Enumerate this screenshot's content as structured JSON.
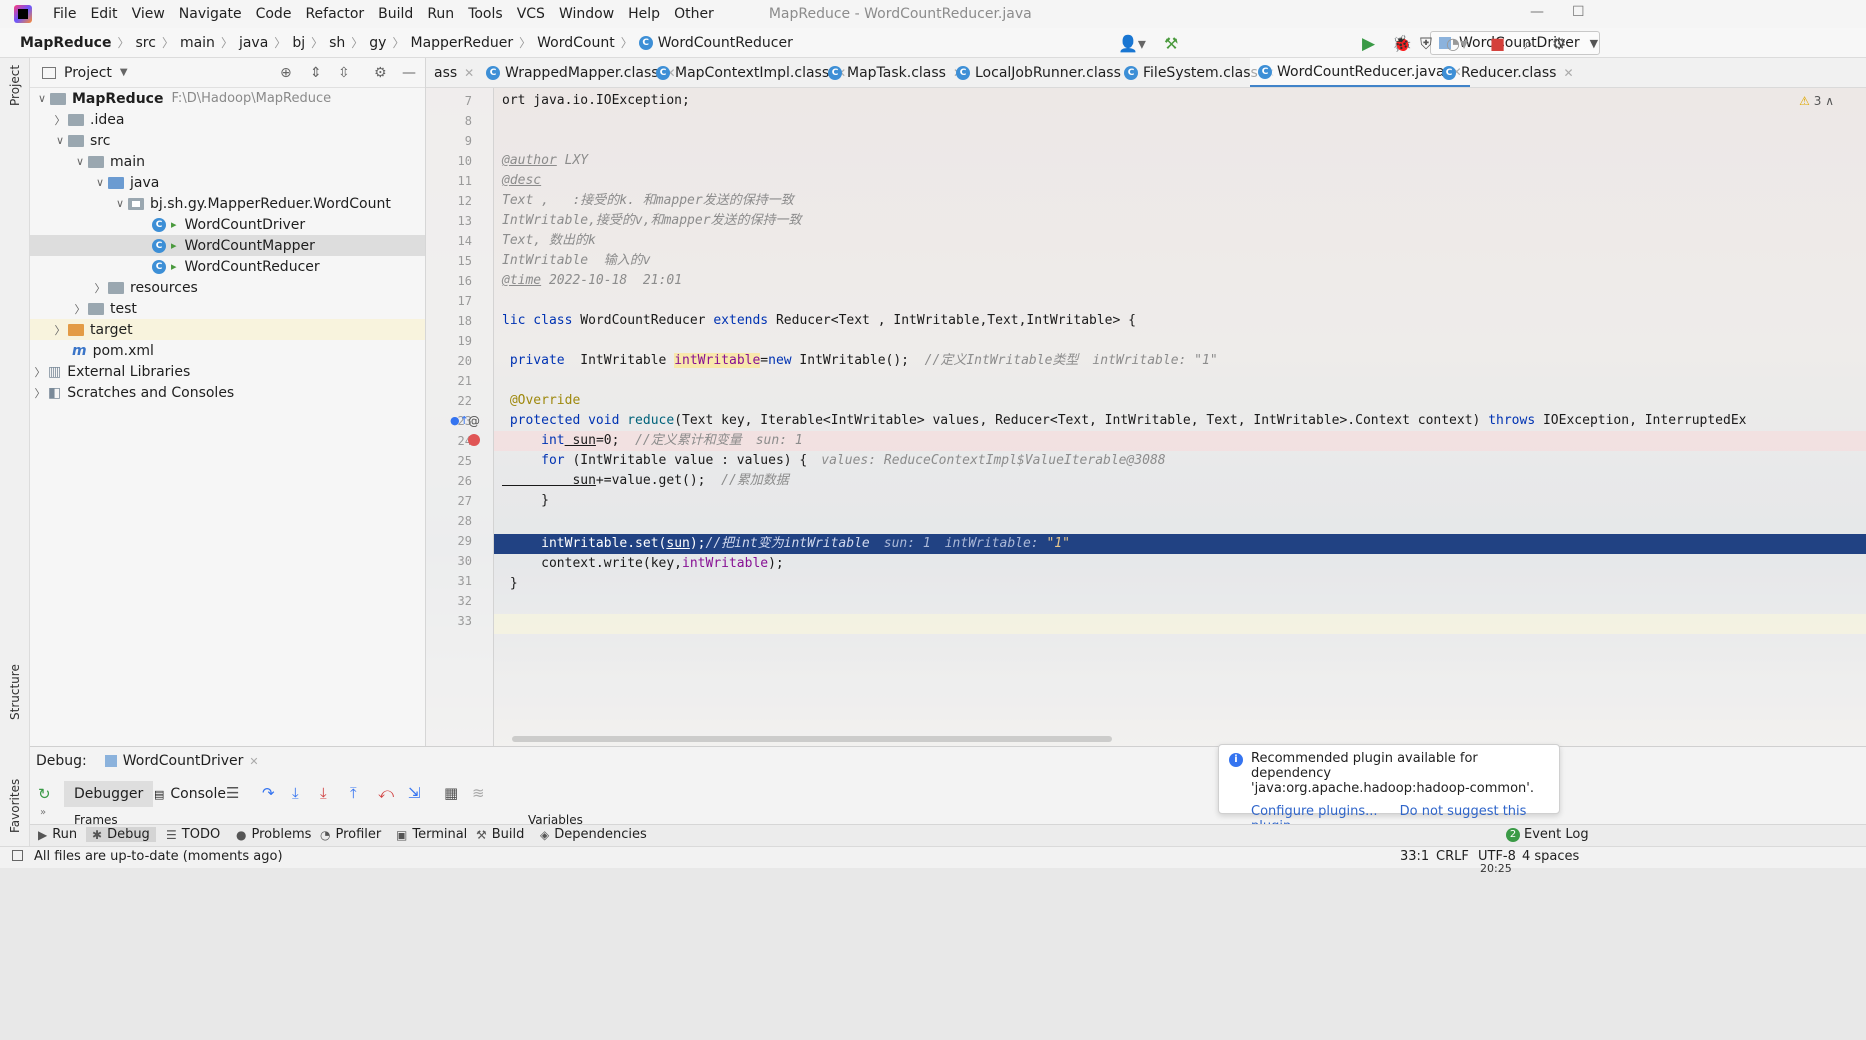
{
  "title_bar": {
    "menus": [
      "File",
      "Edit",
      "View",
      "Navigate",
      "Code",
      "Refactor",
      "Build",
      "Run",
      "Tools",
      "VCS",
      "Window",
      "Help",
      "Other"
    ],
    "window_title": "MapReduce - WordCountReducer.java"
  },
  "nav_bar": {
    "crumbs": [
      "MapReduce",
      "src",
      "main",
      "java",
      "bj",
      "sh",
      "gy",
      "MapperReduer",
      "WordCount",
      "WordCountReducer"
    ],
    "run_config": "WordCountDriver"
  },
  "left_stripe": {
    "project": "Project",
    "structure": "Structure",
    "favorites": "Favorites"
  },
  "project_panel": {
    "title": "Project",
    "tree": [
      {
        "label": "MapReduce",
        "note": "F:\\D\\Hadoop\\MapReduce",
        "icon": "module-folder"
      },
      {
        "label": ".idea",
        "icon": "folder"
      },
      {
        "label": "src",
        "icon": "folder"
      },
      {
        "label": "main",
        "icon": "folder"
      },
      {
        "label": "java",
        "icon": "source-folder"
      },
      {
        "label": "bj.sh.gy.MapperReduer.WordCount",
        "icon": "package"
      },
      {
        "label": "WordCountDriver",
        "icon": "class"
      },
      {
        "label": "WordCountMapper",
        "icon": "class"
      },
      {
        "label": "WordCountReducer",
        "icon": "class"
      },
      {
        "label": "resources",
        "icon": "resources-folder"
      },
      {
        "label": "test",
        "icon": "folder"
      },
      {
        "label": "target",
        "icon": "excluded-folder"
      },
      {
        "label": "pom.xml",
        "icon": "maven-file"
      },
      {
        "label": "External Libraries",
        "icon": "library"
      },
      {
        "label": "Scratches and Consoles",
        "icon": "scratches"
      }
    ]
  },
  "editor_tabs": [
    "ass",
    "WrappedMapper.class",
    "MapContextImpl.class",
    "MapTask.class",
    "LocalJobRunner.class",
    "FileSystem.class",
    "WordCountReducer.java",
    "Reducer.class"
  ],
  "active_tab": "WordCountReducer.java",
  "warnings_count": "3",
  "code": {
    "line_numbers": [
      "7",
      "8",
      "9",
      "10",
      "11",
      "12",
      "13",
      "14",
      "15",
      "16",
      "17",
      "18",
      "19",
      "20",
      "21",
      "22",
      "23",
      "24",
      "25",
      "26",
      "27",
      "28",
      "29",
      "30",
      "31",
      "32",
      "33"
    ],
    "l7": "ort java.io.IOException;",
    "l10_tag": "@author",
    "l10_text": " LXY",
    "l11_tag": "@desc",
    "l12": "Text ,   :接受的k. 和mapper发送的保持一致",
    "l13": "IntWritable,接受的v,和mapper发送的保持一致",
    "l14": "Text, 数出的k",
    "l15": "IntWritable  输入的v",
    "l16_tag": "@time",
    "l16_text": " 2022-10-18  21:01",
    "l18_kw1": "lic class",
    "l18_name": " WordCountReducer ",
    "l18_kw2": "extends",
    "l18_rest": " Reducer<Text , IntWritable,Text,IntWritable> {",
    "l20_kw": " private",
    "l20_type": "  IntWritable ",
    "l20_field": "intWritable",
    "l20_eq": "=",
    "l20_new": "new",
    "l20_rest": " IntWritable();",
    "l20_cmt": "  //定义IntWritable类型",
    "l20_hint": "intWritable: \"1\"",
    "l22_ann": " @Override",
    "l23_kw": " protected void",
    "l23_m": " reduce",
    "l23_rest": "(Text key, Iterable<IntWritable> values, Reducer<Text, IntWritable, Text, IntWritable>.Context context) ",
    "l23_throws": "throws",
    "l23_ex": " IOException, InterruptedEx",
    "l24_kw": "     int",
    "l24_var": " sun",
    "l24_rest": "=0;",
    "l24_cmt": "  //定义累计和变量",
    "l24_hint": "sun: 1",
    "l25_kw": "     for",
    "l25_rest": " (IntWritable value : values) {",
    "l25_hint": "values: ReduceContextImpl$ValueIterable@3088",
    "l26_var": "         sun",
    "l26_rest": "+=value.get();",
    "l26_cmt": "  //累加数据",
    "l27": "     }",
    "l29_code": "     intWritable.set(",
    "l29_var": "sun",
    "l29_rest": ");",
    "l29_cmt": "//把int变为intWritable",
    "l29_hint1": "sun: 1",
    "l29_hint2_k": "intWritable: ",
    "l29_hint2_v": "\"1\"",
    "l30_code": "     context.write(key,",
    "l30_field": "intWritable",
    "l30_rest": ");",
    "l31": " }"
  },
  "debug_panel": {
    "label": "Debug:",
    "session": "WordCountDriver",
    "tabs": [
      "Debugger",
      "Console"
    ],
    "frames": "Frames",
    "variables": "Variables"
  },
  "tool_strip": [
    "Run",
    "Debug",
    "TODO",
    "Problems",
    "Profiler",
    "Terminal",
    "Build",
    "Dependencies"
  ],
  "event_log": {
    "count": "2",
    "label": "Event Log"
  },
  "notification": {
    "line1": "Recommended plugin available for dependency",
    "line2": "'java:org.apache.hadoop:hadoop-common'.",
    "action1": "Configure plugins...",
    "action2": "Do not suggest this plugin"
  },
  "status_bar": {
    "message": "All files are up-to-date (moments ago)",
    "position": "33:1",
    "line_sep": "CRLF",
    "encoding": "UTF-8",
    "indent": "4 spaces",
    "time": "20:25"
  }
}
